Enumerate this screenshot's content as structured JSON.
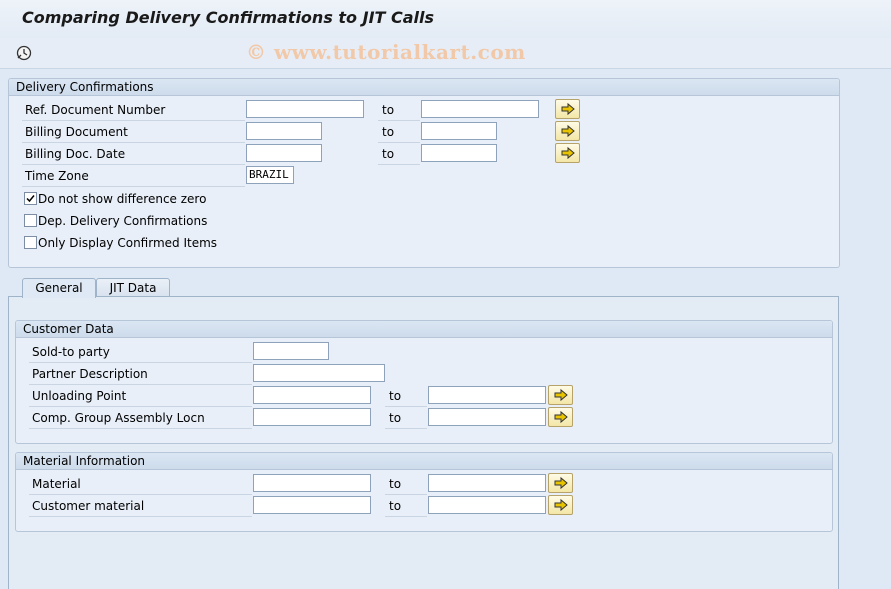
{
  "window": {
    "title": "Comparing Delivery Confirmations to JIT Calls"
  },
  "watermark": "© www.tutorialkart.com",
  "delivery": {
    "header": "Delivery Confirmations",
    "ref_doc_label": "Ref. Document Number",
    "billing_doc_label": "Billing Document",
    "billing_date_label": "Billing Doc. Date",
    "timezone_label": "Time Zone",
    "timezone_value": "BRAZIL",
    "to_label": "to",
    "chk_diff_zero": "Do not show difference zero",
    "chk_diff_zero_checked": true,
    "chk_dep_conf": "Dep. Delivery Confirmations",
    "chk_dep_conf_checked": false,
    "chk_only_confirmed": "Only Display Confirmed Items",
    "chk_only_confirmed_checked": false
  },
  "tabs": [
    {
      "label": "General",
      "active": true
    },
    {
      "label": "JIT Data",
      "active": false
    }
  ],
  "customer": {
    "header": "Customer Data",
    "soldto_label": "Sold-to party",
    "partner_label": "Partner Description",
    "unloading_label": "Unloading Point",
    "compgroup_label": "Comp. Group Assembly Locn",
    "to_label": "to"
  },
  "material": {
    "header": "Material Information",
    "material_label": "Material",
    "custmat_label": "Customer material",
    "to_label": "to"
  },
  "colors": {
    "background": "#dfe9f5",
    "group_header": "#cddbeb",
    "arrow": "#e8c400"
  }
}
